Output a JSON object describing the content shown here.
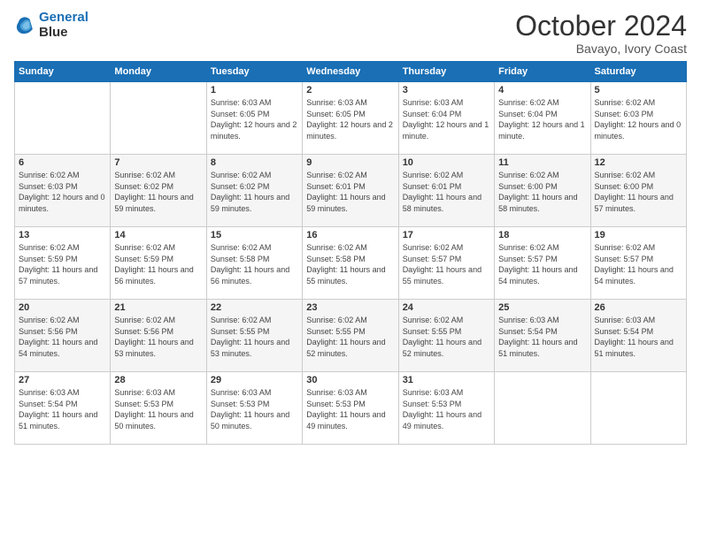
{
  "logo": {
    "line1": "General",
    "line2": "Blue"
  },
  "title": "October 2024",
  "location": "Bavayo, Ivory Coast",
  "days_of_week": [
    "Sunday",
    "Monday",
    "Tuesday",
    "Wednesday",
    "Thursday",
    "Friday",
    "Saturday"
  ],
  "weeks": [
    [
      {
        "day": "",
        "sunrise": "",
        "sunset": "",
        "daylight": ""
      },
      {
        "day": "",
        "sunrise": "",
        "sunset": "",
        "daylight": ""
      },
      {
        "day": "1",
        "sunrise": "Sunrise: 6:03 AM",
        "sunset": "Sunset: 6:05 PM",
        "daylight": "Daylight: 12 hours and 2 minutes."
      },
      {
        "day": "2",
        "sunrise": "Sunrise: 6:03 AM",
        "sunset": "Sunset: 6:05 PM",
        "daylight": "Daylight: 12 hours and 2 minutes."
      },
      {
        "day": "3",
        "sunrise": "Sunrise: 6:03 AM",
        "sunset": "Sunset: 6:04 PM",
        "daylight": "Daylight: 12 hours and 1 minute."
      },
      {
        "day": "4",
        "sunrise": "Sunrise: 6:02 AM",
        "sunset": "Sunset: 6:04 PM",
        "daylight": "Daylight: 12 hours and 1 minute."
      },
      {
        "day": "5",
        "sunrise": "Sunrise: 6:02 AM",
        "sunset": "Sunset: 6:03 PM",
        "daylight": "Daylight: 12 hours and 0 minutes."
      }
    ],
    [
      {
        "day": "6",
        "sunrise": "Sunrise: 6:02 AM",
        "sunset": "Sunset: 6:03 PM",
        "daylight": "Daylight: 12 hours and 0 minutes."
      },
      {
        "day": "7",
        "sunrise": "Sunrise: 6:02 AM",
        "sunset": "Sunset: 6:02 PM",
        "daylight": "Daylight: 11 hours and 59 minutes."
      },
      {
        "day": "8",
        "sunrise": "Sunrise: 6:02 AM",
        "sunset": "Sunset: 6:02 PM",
        "daylight": "Daylight: 11 hours and 59 minutes."
      },
      {
        "day": "9",
        "sunrise": "Sunrise: 6:02 AM",
        "sunset": "Sunset: 6:01 PM",
        "daylight": "Daylight: 11 hours and 59 minutes."
      },
      {
        "day": "10",
        "sunrise": "Sunrise: 6:02 AM",
        "sunset": "Sunset: 6:01 PM",
        "daylight": "Daylight: 11 hours and 58 minutes."
      },
      {
        "day": "11",
        "sunrise": "Sunrise: 6:02 AM",
        "sunset": "Sunset: 6:00 PM",
        "daylight": "Daylight: 11 hours and 58 minutes."
      },
      {
        "day": "12",
        "sunrise": "Sunrise: 6:02 AM",
        "sunset": "Sunset: 6:00 PM",
        "daylight": "Daylight: 11 hours and 57 minutes."
      }
    ],
    [
      {
        "day": "13",
        "sunrise": "Sunrise: 6:02 AM",
        "sunset": "Sunset: 5:59 PM",
        "daylight": "Daylight: 11 hours and 57 minutes."
      },
      {
        "day": "14",
        "sunrise": "Sunrise: 6:02 AM",
        "sunset": "Sunset: 5:59 PM",
        "daylight": "Daylight: 11 hours and 56 minutes."
      },
      {
        "day": "15",
        "sunrise": "Sunrise: 6:02 AM",
        "sunset": "Sunset: 5:58 PM",
        "daylight": "Daylight: 11 hours and 56 minutes."
      },
      {
        "day": "16",
        "sunrise": "Sunrise: 6:02 AM",
        "sunset": "Sunset: 5:58 PM",
        "daylight": "Daylight: 11 hours and 55 minutes."
      },
      {
        "day": "17",
        "sunrise": "Sunrise: 6:02 AM",
        "sunset": "Sunset: 5:57 PM",
        "daylight": "Daylight: 11 hours and 55 minutes."
      },
      {
        "day": "18",
        "sunrise": "Sunrise: 6:02 AM",
        "sunset": "Sunset: 5:57 PM",
        "daylight": "Daylight: 11 hours and 54 minutes."
      },
      {
        "day": "19",
        "sunrise": "Sunrise: 6:02 AM",
        "sunset": "Sunset: 5:57 PM",
        "daylight": "Daylight: 11 hours and 54 minutes."
      }
    ],
    [
      {
        "day": "20",
        "sunrise": "Sunrise: 6:02 AM",
        "sunset": "Sunset: 5:56 PM",
        "daylight": "Daylight: 11 hours and 54 minutes."
      },
      {
        "day": "21",
        "sunrise": "Sunrise: 6:02 AM",
        "sunset": "Sunset: 5:56 PM",
        "daylight": "Daylight: 11 hours and 53 minutes."
      },
      {
        "day": "22",
        "sunrise": "Sunrise: 6:02 AM",
        "sunset": "Sunset: 5:55 PM",
        "daylight": "Daylight: 11 hours and 53 minutes."
      },
      {
        "day": "23",
        "sunrise": "Sunrise: 6:02 AM",
        "sunset": "Sunset: 5:55 PM",
        "daylight": "Daylight: 11 hours and 52 minutes."
      },
      {
        "day": "24",
        "sunrise": "Sunrise: 6:02 AM",
        "sunset": "Sunset: 5:55 PM",
        "daylight": "Daylight: 11 hours and 52 minutes."
      },
      {
        "day": "25",
        "sunrise": "Sunrise: 6:03 AM",
        "sunset": "Sunset: 5:54 PM",
        "daylight": "Daylight: 11 hours and 51 minutes."
      },
      {
        "day": "26",
        "sunrise": "Sunrise: 6:03 AM",
        "sunset": "Sunset: 5:54 PM",
        "daylight": "Daylight: 11 hours and 51 minutes."
      }
    ],
    [
      {
        "day": "27",
        "sunrise": "Sunrise: 6:03 AM",
        "sunset": "Sunset: 5:54 PM",
        "daylight": "Daylight: 11 hours and 51 minutes."
      },
      {
        "day": "28",
        "sunrise": "Sunrise: 6:03 AM",
        "sunset": "Sunset: 5:53 PM",
        "daylight": "Daylight: 11 hours and 50 minutes."
      },
      {
        "day": "29",
        "sunrise": "Sunrise: 6:03 AM",
        "sunset": "Sunset: 5:53 PM",
        "daylight": "Daylight: 11 hours and 50 minutes."
      },
      {
        "day": "30",
        "sunrise": "Sunrise: 6:03 AM",
        "sunset": "Sunset: 5:53 PM",
        "daylight": "Daylight: 11 hours and 49 minutes."
      },
      {
        "day": "31",
        "sunrise": "Sunrise: 6:03 AM",
        "sunset": "Sunset: 5:53 PM",
        "daylight": "Daylight: 11 hours and 49 minutes."
      },
      {
        "day": "",
        "sunrise": "",
        "sunset": "",
        "daylight": ""
      },
      {
        "day": "",
        "sunrise": "",
        "sunset": "",
        "daylight": ""
      }
    ]
  ]
}
